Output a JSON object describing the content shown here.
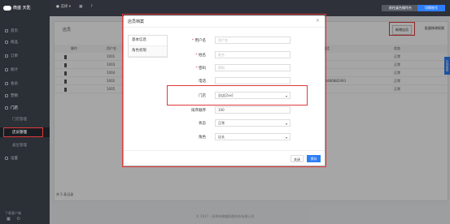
{
  "sidebar": {
    "brand": "微盛 天匙",
    "items": [
      {
        "icon": "home-icon",
        "label": "首页"
      },
      {
        "icon": "goods-icon",
        "label": "商品"
      },
      {
        "icon": "order-icon",
        "label": "订单"
      },
      {
        "icon": "stats-icon",
        "label": "统计"
      },
      {
        "icon": "member-icon",
        "label": "会员"
      },
      {
        "icon": "marketing-icon",
        "label": "营销"
      },
      {
        "icon": "store-icon",
        "label": "门店"
      }
    ],
    "subitems": [
      "门店管理",
      "店员管理",
      "桌位管理"
    ],
    "settings": {
      "icon": "settings-icon",
      "label": "设置"
    },
    "bottom_text": "下载客户端"
  },
  "topbar": {
    "store_select": "选择",
    "btn_enter": "前往桌台操作台",
    "btn_login": "切换账号"
  },
  "content": {
    "title": "店员",
    "add_button": "新增店员",
    "batch_button": "批量修改权限",
    "columns": [
      "操作",
      "用户名",
      "姓名",
      "手机",
      "最近登录IP",
      "电话",
      "状态"
    ],
    "rows": [
      {
        "id": "1001",
        "ip": "218.17.161.82",
        "phone": "",
        "status": "正常"
      },
      {
        "id": "1003",
        "ip": "218.17.161.82",
        "phone": "",
        "status": "正常"
      },
      {
        "id": "1004",
        "ip": "218.17.161.82",
        "phone": "",
        "status": "正常"
      },
      {
        "id": "1002",
        "ip": "218.17.161.82",
        "phone": "13480882493",
        "status": "正常"
      },
      {
        "id": "1005",
        "ip": "218.17.161.82",
        "phone": "",
        "status": "正常"
      }
    ],
    "total": "共 5 条记录"
  },
  "float_tab": "在线客服",
  "footer": "© 2017 - 深圳市微盛网络科技有限公司",
  "modal": {
    "title": "店员档案",
    "tabs": [
      "基本信息",
      "角色权限"
    ],
    "fields": {
      "username": {
        "label": "用户名",
        "required": true,
        "placeholder": "用户名",
        "value": ""
      },
      "name": {
        "label": "姓名",
        "required": true,
        "placeholder": "姓名",
        "value": ""
      },
      "password": {
        "label": "密码",
        "required": true,
        "placeholder": "密码",
        "value": ""
      },
      "mobile": {
        "label": "电话",
        "required": false,
        "placeholder": "",
        "value": ""
      },
      "store": {
        "label": "门店",
        "required": false,
        "value": "总店[2xx]"
      },
      "order": {
        "label": "排序顺序",
        "required": false,
        "value": "100"
      },
      "status": {
        "label": "状态",
        "required": false,
        "value": "正常"
      },
      "role": {
        "label": "角色",
        "required": false,
        "value": "店长"
      }
    },
    "cancel": "关闭",
    "save": "保存"
  }
}
